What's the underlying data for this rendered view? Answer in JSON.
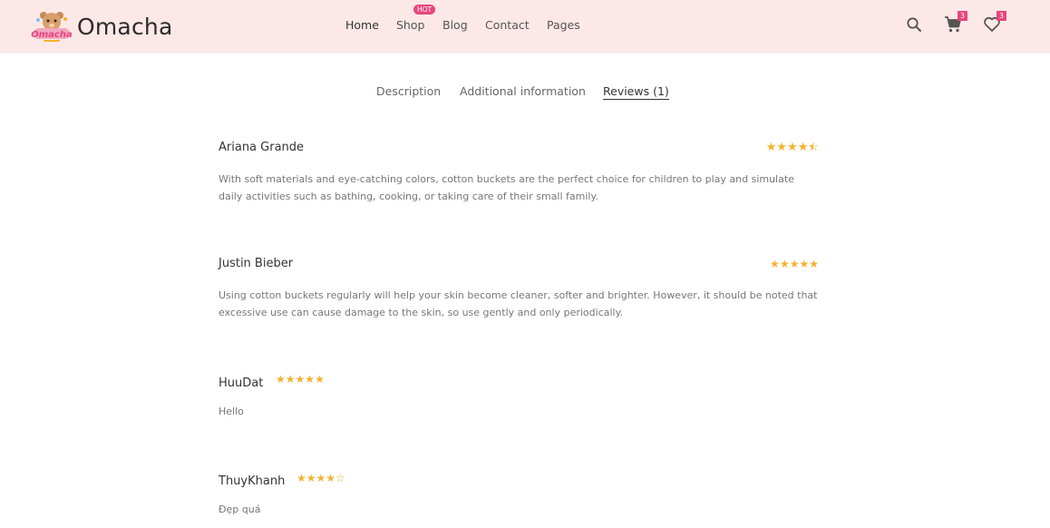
{
  "header": {
    "brand": "Omacha",
    "nav": [
      {
        "label": "Home"
      },
      {
        "label": "Shop",
        "badge": "HOT"
      },
      {
        "label": "Blog"
      },
      {
        "label": "Contact"
      },
      {
        "label": "Pages"
      }
    ],
    "cart_count": "3",
    "wishlist_count": "3",
    "icons": [
      "search-icon",
      "cart-icon",
      "heart-icon"
    ]
  },
  "tabs": [
    {
      "label": "Description"
    },
    {
      "label": "Additional information"
    },
    {
      "label": "Reviews (1)"
    }
  ],
  "reviews": [
    {
      "name": "Ariana Grande",
      "rating": 4.5,
      "text": "With soft materials and eye-catching colors, cotton buckets are the perfect choice for children to play and simulate daily activities such as bathing, cooking, or taking care of their small family."
    },
    {
      "name": "Justin Bieber",
      "rating": 5,
      "text": "Using cotton buckets regularly will help your skin become cleaner, softer and brighter. However, it should be noted that excessive use can cause damage to the skin, so use gently and only periodically."
    },
    {
      "name": "HuuDat",
      "rating": 5,
      "text": "Hello"
    },
    {
      "name": "ThuyKhanh",
      "rating": 4,
      "text": "Đẹp quá"
    }
  ],
  "colors": {
    "header_bg": "#fde8e8",
    "accent": "#e8457d",
    "star": "#f5b22e"
  }
}
